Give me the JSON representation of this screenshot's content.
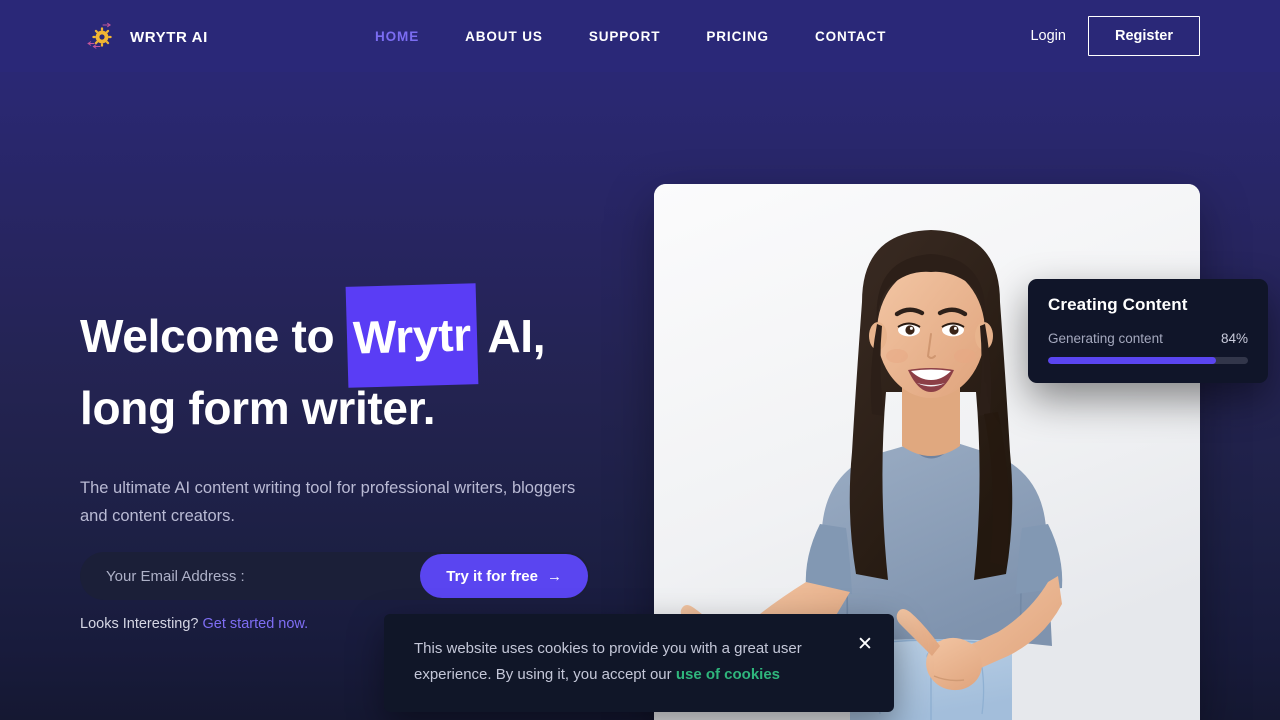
{
  "header": {
    "brand": {
      "icon": "gear-sun-icon",
      "name": "WRYTR AI"
    },
    "nav": [
      {
        "label": "HOME",
        "active": true
      },
      {
        "label": "ABOUT US",
        "active": false
      },
      {
        "label": "SUPPORT",
        "active": false
      },
      {
        "label": "PRICING",
        "active": false
      },
      {
        "label": "CONTACT",
        "active": false
      }
    ],
    "login_label": "Login",
    "register_label": "Register"
  },
  "hero": {
    "headline_part1": "Welcome to ",
    "headline_highlight": "Wrytr",
    "headline_part2": " AI,",
    "headline_line2": "long form writer.",
    "subhead": "The ultimate AI content writing tool for professional writers, bloggers and content creators.",
    "email_placeholder": "Your Email Address :",
    "email_value": "",
    "cta_label": "Try it for free",
    "cta_arrow": "→",
    "looks_prefix": "Looks Interesting? ",
    "looks_link": "Get started now."
  },
  "progress_card": {
    "title": "Creating Content",
    "label": "Generating content",
    "percent_text": "84%",
    "percent_value": 84
  },
  "cookie": {
    "text_part1": "This website uses cookies to provide you with a great user experience. By using it, you accept our ",
    "link_label": "use of cookies",
    "close_icon": "close-icon",
    "close_glyph": "✕"
  },
  "colors": {
    "header_bg": "#2a2878",
    "page_top": "#2b2979",
    "page_bottom": "#151832",
    "accent_purple": "#5a45f0",
    "highlight_purple": "#5a3df5",
    "nav_active": "#7b6df2",
    "link_purple": "#7f6ef5",
    "cookie_link_green": "#2fb67c",
    "card_bg": "#101529",
    "input_bg": "#1b1f38",
    "logo_gold": "#f2b632"
  }
}
